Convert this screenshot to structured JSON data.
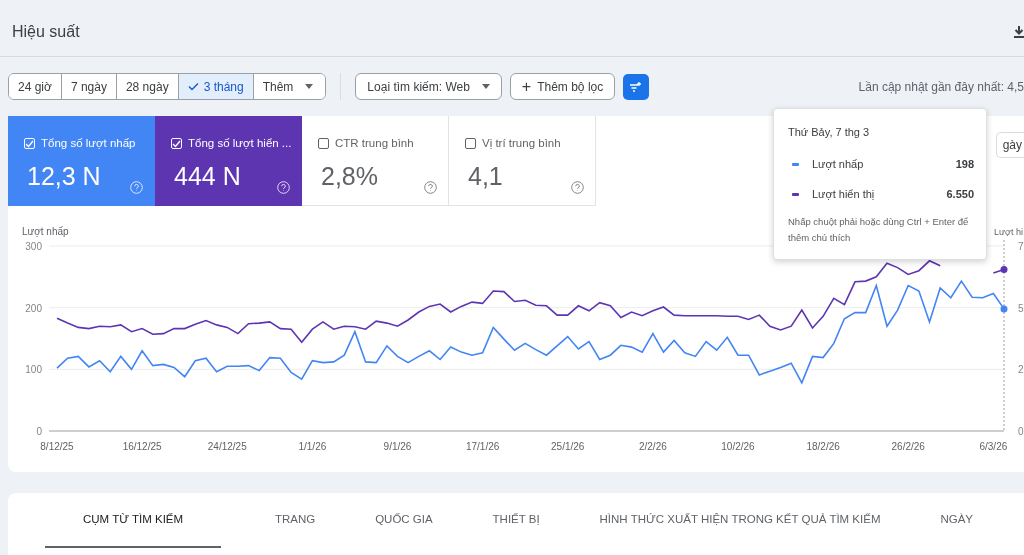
{
  "header": {
    "title": "Hiệu suất"
  },
  "filters": {
    "ranges": [
      {
        "label": "24 giờ",
        "selected": false
      },
      {
        "label": "7 ngày",
        "selected": false
      },
      {
        "label": "28 ngày",
        "selected": false
      },
      {
        "label": "3 tháng",
        "selected": true
      }
    ],
    "more": "Thêm",
    "search_type": "Loại tìm kiếm: Web",
    "add_filter": "Thêm bộ lọc",
    "add_symbol": "+",
    "last_update": "Lần cập nhật gần đây nhất: 4,5"
  },
  "metrics": [
    {
      "label": "Tổng số lượt nhấp",
      "value": "12,3 N",
      "checked": true,
      "color": "#4285f4"
    },
    {
      "label": "Tổng số lượt hiển ...",
      "value": "444 N",
      "checked": true,
      "color": "#5e35b1"
    },
    {
      "label": "CTR trung bình",
      "value": "2,8%",
      "checked": false
    },
    {
      "label": "Vị trí trung bình",
      "value": "4,1",
      "checked": false
    }
  ],
  "period_button": "gày",
  "chart": {
    "right_axis": {
      "label": "Lượt hi",
      "ticks": [
        "7",
        "5",
        "2",
        "0"
      ]
    },
    "chart_data": {
      "type": "line",
      "ylabel": "Lượt nhấp",
      "ylim": [
        0,
        300
      ],
      "yticks": [
        0,
        100,
        200,
        300
      ],
      "categories": [
        "8/12/25",
        null,
        null,
        null,
        null,
        null,
        null,
        null,
        "16/12/25",
        null,
        null,
        null,
        null,
        null,
        null,
        null,
        "24/12/25",
        null,
        null,
        null,
        null,
        null,
        null,
        null,
        "1/1/26",
        null,
        null,
        null,
        null,
        null,
        null,
        null,
        "9/1/26",
        null,
        null,
        null,
        null,
        null,
        null,
        null,
        "17/1/26",
        null,
        null,
        null,
        null,
        null,
        null,
        null,
        "25/1/26",
        null,
        null,
        null,
        null,
        null,
        null,
        null,
        "2/2/26",
        null,
        null,
        null,
        null,
        null,
        null,
        null,
        "10/2/26",
        null,
        null,
        null,
        null,
        null,
        null,
        null,
        "18/2/26",
        null,
        null,
        null,
        null,
        null,
        null,
        null,
        "26/2/26",
        null,
        null,
        null,
        null,
        null,
        null,
        null,
        "6/3/26",
        null
      ],
      "series": [
        {
          "color": "#4285f4",
          "values": [
            102,
            118,
            121,
            104,
            114,
            96,
            121,
            100,
            130,
            106,
            108,
            103,
            88,
            114,
            118,
            96,
            105,
            105,
            106,
            98,
            119,
            118,
            95,
            84,
            114,
            111,
            112,
            123,
            161,
            112,
            111,
            138,
            121,
            111,
            121,
            130,
            116,
            136,
            128,
            123,
            127,
            168,
            149,
            131,
            142,
            132,
            123,
            138,
            153,
            133,
            145,
            116,
            123,
            139,
            136,
            128,
            158,
            128,
            147,
            127,
            121,
            145,
            131,
            152,
            123,
            123,
            91,
            97,
            103,
            110,
            78,
            121,
            119,
            142,
            182,
            192,
            192,
            236,
            170,
            196,
            236,
            227,
            177,
            232,
            216,
            243,
            217,
            216,
            223,
            198
          ]
        },
        {
          "color": "#5e35b1",
          "values": [
            183,
            175,
            168,
            166,
            170,
            169,
            172,
            161,
            166,
            157,
            158,
            166,
            166,
            173,
            179,
            172,
            168,
            158,
            174,
            175,
            177,
            166,
            165,
            144,
            165,
            177,
            165,
            170,
            169,
            165,
            178,
            175,
            170,
            180,
            193,
            202,
            206,
            193,
            202,
            209,
            207,
            227,
            226,
            210,
            212,
            204,
            203,
            188,
            188,
            203,
            195,
            208,
            203,
            184,
            193,
            187,
            195,
            201,
            188,
            187,
            187,
            187,
            187,
            186,
            186,
            181,
            188,
            170,
            164,
            170,
            196,
            167,
            186,
            215,
            205,
            242,
            243,
            250,
            272,
            265,
            254,
            260,
            276,
            268,
            null,
            null,
            null,
            null,
            256,
            262
          ]
        }
      ]
    }
  },
  "tooltip": {
    "date": "Thứ Bảy, 7 thg 3",
    "rows": [
      {
        "label": "Lượt nhấp",
        "value": "198",
        "color": "#4285f4"
      },
      {
        "label": "Lượt hiển thị",
        "value": "6.550",
        "color": "#5e35b1"
      }
    ],
    "note": "Nhấp chuột phải hoặc dùng Ctrl + Enter để thêm chú thích"
  },
  "tabs": [
    {
      "label": "CỤM TỪ TÌM KIẾM",
      "selected": true
    },
    {
      "label": "TRANG",
      "selected": false
    },
    {
      "label": "QUỐC GIA",
      "selected": false
    },
    {
      "label": "THIẾT BỊ",
      "selected": false
    },
    {
      "label": "HÌNH THỨC XUẤT HIỆN TRONG KẾT QUẢ TÌM KIẾM",
      "selected": false
    },
    {
      "label": "NGÀY",
      "selected": false
    }
  ]
}
